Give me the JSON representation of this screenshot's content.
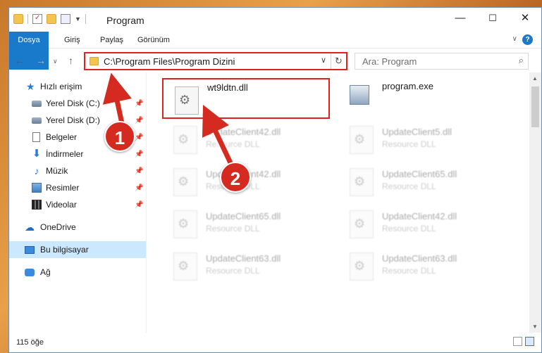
{
  "window": {
    "title": "Program",
    "buttons": {
      "minimize": "—",
      "maximize": "☐",
      "close": "✕"
    }
  },
  "ribbon": {
    "tabs": [
      "Dosya",
      "Giriş",
      "Paylaş",
      "Görünüm"
    ],
    "help": "?"
  },
  "address": {
    "path": "C:\\Program Files\\Program Dizini",
    "search_placeholder": "Ara: Program"
  },
  "sidebar": {
    "items": [
      {
        "label": "Hızlı erişim",
        "icon": "star-icon"
      },
      {
        "label": "Yerel Disk (C:)",
        "icon": "drive-icon",
        "pinned": true
      },
      {
        "label": "Yerel Disk (D:)",
        "icon": "drive-icon",
        "pinned": true
      },
      {
        "label": "Belgeler",
        "icon": "document-icon",
        "pinned": true
      },
      {
        "label": "İndirmeler",
        "icon": "download-icon",
        "pinned": true
      },
      {
        "label": "Müzik",
        "icon": "music-icon",
        "pinned": true
      },
      {
        "label": "Resimler",
        "icon": "pictures-icon",
        "pinned": true
      },
      {
        "label": "Videolar",
        "icon": "video-icon",
        "pinned": true
      },
      {
        "label": "OneDrive",
        "icon": "cloud-icon"
      },
      {
        "label": "Bu bilgisayar",
        "icon": "computer-icon",
        "selected": true
      },
      {
        "label": "Ağ",
        "icon": "network-icon"
      }
    ]
  },
  "files": [
    {
      "name": "wt9ldtn.dll",
      "type": ""
    },
    {
      "name": "program.exe",
      "type": ""
    },
    {
      "name": "UpdateClient42.dll",
      "type": "Resource DLL"
    },
    {
      "name": "UpdateClient5.dll",
      "type": "Resource DLL"
    },
    {
      "name": "UpdateClient42.dll",
      "type": "Resource DLL"
    },
    {
      "name": "UpdateClient65.dll",
      "type": "Resource DLL"
    },
    {
      "name": "UpdateClient65.dll",
      "type": "Resource DLL"
    },
    {
      "name": "UpdateClient42.dll",
      "type": "Resource DLL"
    },
    {
      "name": "UpdateClient63.dll",
      "type": "Resource DLL"
    },
    {
      "name": "UpdateClient63.dll",
      "type": "Resource DLL"
    }
  ],
  "status": {
    "count": "115 öğe"
  },
  "annotations": {
    "badge1": "1",
    "badge2": "2"
  },
  "colors": {
    "accent": "#1979ca",
    "highlight_red": "#e0211d",
    "selection": "#cce8ff"
  }
}
